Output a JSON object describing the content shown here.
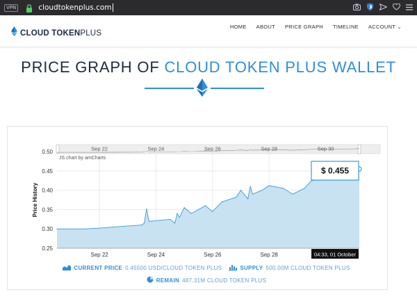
{
  "browser": {
    "vpn_label": "VPN",
    "url": "cloudtokenplus.com"
  },
  "header": {
    "logo": {
      "word1": "CLOUD",
      "word2": "TOKEN",
      "word3": "PLUS"
    },
    "nav": [
      {
        "label": "HOME"
      },
      {
        "label": "ABOUT"
      },
      {
        "label": "PRICE GRAPH"
      },
      {
        "label": "TIMELINE"
      },
      {
        "label": "ACCOUNT ⌄"
      }
    ]
  },
  "page": {
    "title_main": "PRICE GRAPH OF ",
    "title_accent": "CLOUD TOKEN PLUS WALLET"
  },
  "colors": {
    "accent": "#2f8fd8",
    "dark": "#1b2b3f",
    "area_fill": "#c8e2f2",
    "area_stroke": "#3c9ad8"
  },
  "chart_data": {
    "type": "area",
    "ylabel": "Price History",
    "xlabel": "",
    "credit": "JS chart by amCharts",
    "ylim": [
      0.25,
      0.5
    ],
    "y_ticks": [
      "0.50",
      "0.45",
      "0.40",
      "0.35",
      "0.30",
      "0.25"
    ],
    "x_ticks": [
      "Sep 22",
      "Sep 24",
      "Sep 26",
      "Sep 28"
    ],
    "scrollbar_ticks": [
      "Sep 22",
      "Sep 24",
      "Sep 26",
      "Sep 28",
      "Sep 30"
    ],
    "x_start": "2019-09-20T12:00",
    "x_end": "2019-10-01T04:33",
    "series": [
      {
        "points": [
          [
            "2019-09-20T12:00",
            0.3
          ],
          [
            "2019-09-21T12:00",
            0.3
          ],
          [
            "2019-09-22T00:00",
            0.302
          ],
          [
            "2019-09-22T12:00",
            0.305
          ],
          [
            "2019-09-23T12:00",
            0.31
          ],
          [
            "2019-09-23T14:00",
            0.315
          ],
          [
            "2019-09-23T16:00",
            0.352
          ],
          [
            "2019-09-23T18:00",
            0.32
          ],
          [
            "2019-09-23T20:00",
            0.32
          ],
          [
            "2019-09-24T12:00",
            0.325
          ],
          [
            "2019-09-24T16:00",
            0.315
          ],
          [
            "2019-09-24T18:00",
            0.34
          ],
          [
            "2019-09-24T20:00",
            0.33
          ],
          [
            "2019-09-25T00:00",
            0.355
          ],
          [
            "2019-09-25T06:00",
            0.34
          ],
          [
            "2019-09-25T18:00",
            0.36
          ],
          [
            "2019-09-26T00:00",
            0.345
          ],
          [
            "2019-09-26T08:00",
            0.37
          ],
          [
            "2019-09-26T18:00",
            0.38
          ],
          [
            "2019-09-26T20:00",
            0.382
          ],
          [
            "2019-09-27T00:00",
            0.4
          ],
          [
            "2019-09-27T06:00",
            0.378
          ],
          [
            "2019-09-27T08:00",
            0.41
          ],
          [
            "2019-09-27T10:00",
            0.39
          ],
          [
            "2019-09-27T18:00",
            0.4
          ],
          [
            "2019-09-28T00:00",
            0.412
          ],
          [
            "2019-09-28T12:00",
            0.405
          ],
          [
            "2019-09-28T20:00",
            0.39
          ],
          [
            "2019-09-29T06:00",
            0.405
          ],
          [
            "2019-09-29T12:00",
            0.425
          ],
          [
            "2019-09-30T00:00",
            0.43
          ],
          [
            "2019-09-30T12:00",
            0.435
          ],
          [
            "2019-10-01T00:00",
            0.44
          ],
          [
            "2019-10-01T04:33",
            0.455
          ]
        ]
      }
    ],
    "tooltip_value": "$ 0.455",
    "cursor_label": "04:33, 01 October"
  },
  "summary": {
    "current_price_label": "CURRENT PRICE",
    "current_price_value": "0.45500 USD/CLOUD TOKEN PLUS",
    "supply_label": "SUPPLY",
    "supply_value": "500.00M CLOUD TOKEN PLUS",
    "remain_label": "REMAIN",
    "remain_value": "487.31M CLOUD TOKEN PLUS"
  }
}
